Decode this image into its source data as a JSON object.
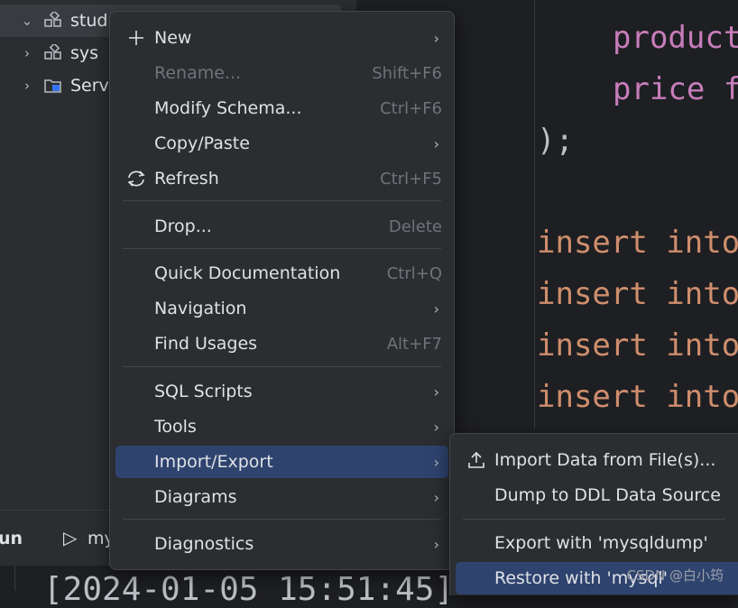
{
  "tree": {
    "items": [
      {
        "label": "stud",
        "icon": "schema-icon",
        "expanded": true
      },
      {
        "label": "sys",
        "icon": "schema-icon",
        "expanded": false
      },
      {
        "label": "Serv",
        "icon": "server-objects-icon",
        "expanded": false
      }
    ]
  },
  "editor": {
    "lines": [
      {
        "a": "product",
        "type": "field"
      },
      {
        "a": "price f",
        "type": "field"
      },
      {
        "a": ");",
        "type": "plain"
      },
      {
        "a": "insert into",
        "type": "kw"
      },
      {
        "a": "insert into",
        "type": "kw"
      },
      {
        "a": "insert into",
        "type": "kw"
      },
      {
        "a": "insert into",
        "type": "kw"
      }
    ]
  },
  "runbar": {
    "run_label": "un",
    "tab_label": "my"
  },
  "console": {
    "text": "[2024-01-05 15:51:45]"
  },
  "context_menu": {
    "items": [
      {
        "label": "New",
        "shortcut": "",
        "submenu": true,
        "icon": "plus-icon",
        "disabled": false
      },
      {
        "label": "Rename...",
        "shortcut": "Shift+F6",
        "submenu": false,
        "icon": "",
        "disabled": true
      },
      {
        "label": "Modify Schema...",
        "shortcut": "Ctrl+F6",
        "submenu": false,
        "icon": "",
        "disabled": false
      },
      {
        "label": "Copy/Paste",
        "shortcut": "",
        "submenu": true,
        "icon": "",
        "disabled": false
      },
      {
        "label": "Refresh",
        "shortcut": "Ctrl+F5",
        "submenu": false,
        "icon": "refresh-icon",
        "disabled": false
      },
      {
        "label": "Drop...",
        "shortcut": "Delete",
        "submenu": false,
        "icon": "",
        "disabled": false
      },
      {
        "label": "Quick Documentation",
        "shortcut": "Ctrl+Q",
        "submenu": false,
        "icon": "",
        "disabled": false
      },
      {
        "label": "Navigation",
        "shortcut": "",
        "submenu": true,
        "icon": "",
        "disabled": false
      },
      {
        "label": "Find Usages",
        "shortcut": "Alt+F7",
        "submenu": false,
        "icon": "",
        "disabled": false
      },
      {
        "label": "SQL Scripts",
        "shortcut": "",
        "submenu": true,
        "icon": "",
        "disabled": false
      },
      {
        "label": "Tools",
        "shortcut": "",
        "submenu": true,
        "icon": "",
        "disabled": false
      },
      {
        "label": "Import/Export",
        "shortcut": "",
        "submenu": true,
        "icon": "",
        "disabled": false,
        "highlighted": true
      },
      {
        "label": "Diagrams",
        "shortcut": "",
        "submenu": true,
        "icon": "",
        "disabled": false
      },
      {
        "label": "Diagnostics",
        "shortcut": "",
        "submenu": true,
        "icon": "",
        "disabled": false
      }
    ]
  },
  "submenu": {
    "items": [
      {
        "label": "Import Data from File(s)...",
        "icon": "upload-icon"
      },
      {
        "label": "Dump to DDL Data Source",
        "icon": ""
      },
      {
        "label": "Export with 'mysqldump'",
        "icon": ""
      },
      {
        "label": "Restore with 'mysql'",
        "icon": "",
        "highlighted": true
      }
    ]
  },
  "watermark": "CSDN @白小筠",
  "colors": {
    "background": "#1e1f22",
    "panel": "#2b2d30",
    "highlight": "#2e436e",
    "keyword": "#cf8e6d",
    "field": "#c77dbb"
  }
}
